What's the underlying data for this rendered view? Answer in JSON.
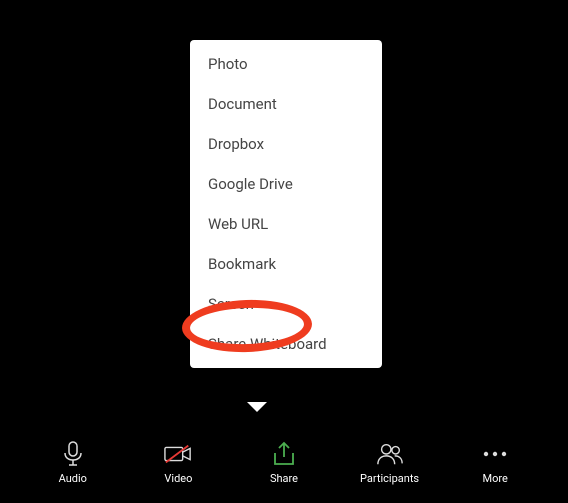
{
  "share_menu": {
    "items": [
      {
        "label": "Photo"
      },
      {
        "label": "Document"
      },
      {
        "label": "Dropbox"
      },
      {
        "label": "Google Drive"
      },
      {
        "label": "Web URL"
      },
      {
        "label": "Bookmark"
      },
      {
        "label": "Screen"
      },
      {
        "label": "Share Whiteboard"
      }
    ]
  },
  "toolbar": {
    "audio": {
      "label": "Audio"
    },
    "video": {
      "label": "Video"
    },
    "share": {
      "label": "Share"
    },
    "participants": {
      "label": "Participants"
    },
    "more": {
      "label": "More"
    }
  },
  "highlight": {
    "target": "Screen",
    "color": "#ef3c1f"
  },
  "colors": {
    "share_icon": "#4caf50",
    "video_off_slash": "#e53935"
  }
}
